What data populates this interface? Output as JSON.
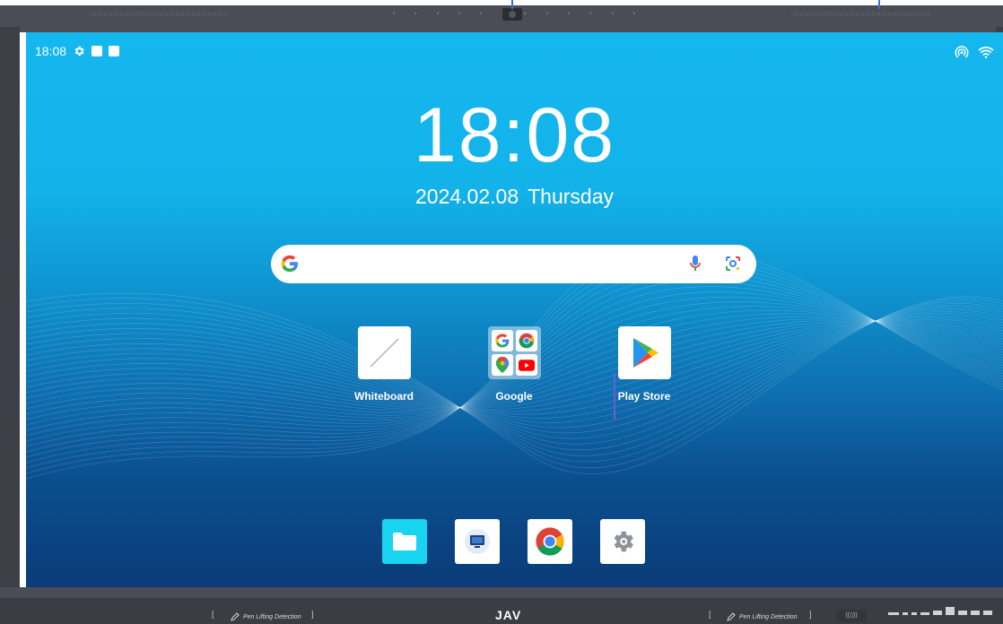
{
  "status_bar": {
    "time": "18:08",
    "icons_left": [
      "gear-icon",
      "square-icon",
      "square-icon"
    ],
    "icons_right": [
      "hotspot-icon",
      "wifi-icon"
    ]
  },
  "clock": {
    "time": "18:08",
    "date": "2024.02.08",
    "weekday": "Thursday"
  },
  "search": {
    "value": "",
    "placeholder": ""
  },
  "apps": [
    {
      "label": "Whiteboard",
      "icon": "whiteboard-icon"
    },
    {
      "label": "Google",
      "icon": "google-folder-icon"
    },
    {
      "label": "Play Store",
      "icon": "play-store-icon"
    }
  ],
  "dock": [
    "files-icon",
    "screen-cast-icon",
    "chrome-icon",
    "settings-icon"
  ],
  "bezel": {
    "left_pen": "Pen Lifting Detection",
    "right_pen": "Pen Lifting Detection",
    "brand": "JAV",
    "open_bracket": "[",
    "close_bracket": "]"
  },
  "colors": {
    "screen_top": "#14b7ee",
    "screen_bottom": "#0a3c78",
    "files_tile": "#18d4f0",
    "bezel": "#4a4d55"
  }
}
